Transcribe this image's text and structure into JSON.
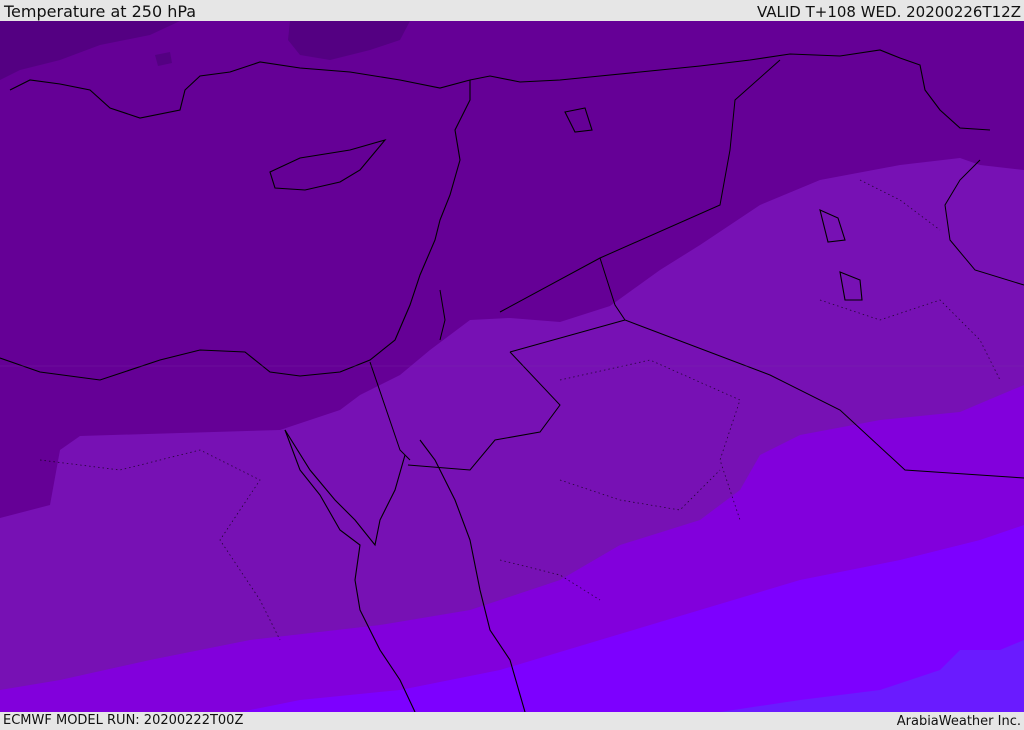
{
  "header": {
    "title": "Temperature at 250 hPa",
    "valid": "VALID T+108 WED. 20200226T12Z"
  },
  "footer": {
    "model_run": "ECMWF MODEL RUN: 20200222T00Z",
    "credit": "ArabiaWeather Inc."
  },
  "colors": {
    "band_darkest": "#540082",
    "band_1": "#650096",
    "band_2": "#7711b4",
    "band_3": "#8200dc",
    "band_4": "#7d00ff",
    "band_5": "#6a1bff",
    "coastline": "#000000"
  }
}
